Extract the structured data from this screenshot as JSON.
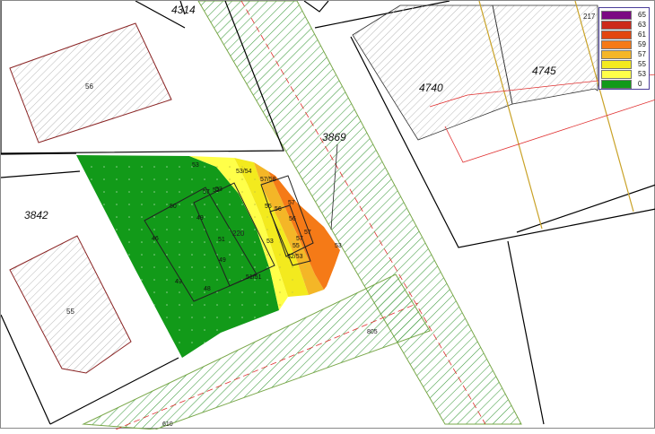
{
  "parcels": {
    "p4314": "4314",
    "p4740": "4740",
    "p4745": "4745",
    "p3869": "3869",
    "p3842": "3842"
  },
  "buildings": {
    "b56": "56",
    "b55": "55",
    "b220": "220",
    "b217": "217"
  },
  "road_labels": {
    "b805": "805",
    "b610": "610"
  },
  "legend": {
    "items": [
      {
        "value": "65",
        "color": "#7b0a83"
      },
      {
        "value": "63",
        "color": "#cc2a1a"
      },
      {
        "value": "61",
        "color": "#e2460e"
      },
      {
        "value": "59",
        "color": "#f57a17"
      },
      {
        "value": "57",
        "color": "#f4b627"
      },
      {
        "value": "55",
        "color": "#f3ea1e"
      },
      {
        "value": "53",
        "color": "#ffff49"
      },
      {
        "value": "0",
        "color": "#129a19"
      }
    ]
  },
  "contour_labels": [
    "53",
    "53/54",
    "57/58",
    "53",
    "55",
    "56",
    "57",
    "56",
    "57",
    "55",
    "57",
    "52/53",
    "53",
    "50",
    "49",
    "57",
    "52",
    "51",
    "49",
    "46",
    "49",
    "48",
    "51/51",
    "53"
  ],
  "colors": {
    "green_zone": "#129a19",
    "hatch_road": "#3f9b3f",
    "parcel_line": "#000000",
    "building_outline": "#8a2424",
    "red_dash": "#e03030",
    "gold_line": "#c9a227"
  }
}
